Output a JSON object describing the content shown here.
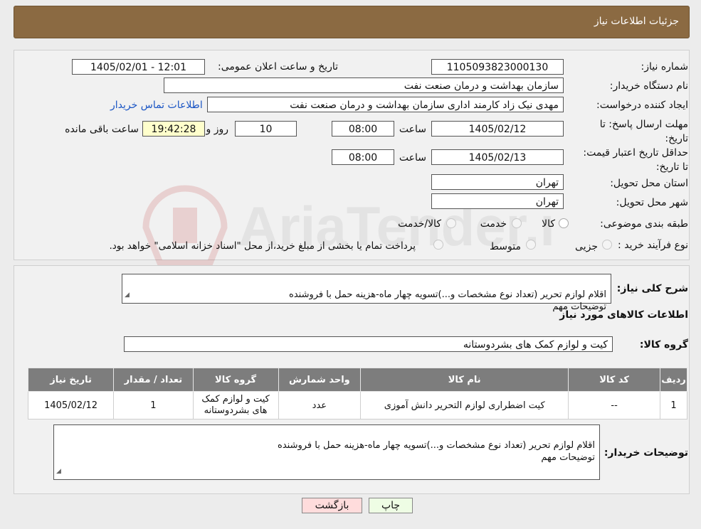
{
  "header": {
    "title": "جزئیات اطلاعات نیاز"
  },
  "form": {
    "need_number_label": "شماره نیاز:",
    "need_number": "1105093823000130",
    "announce_label": "تاریخ و ساعت اعلان عمومی:",
    "announce_value": "1405/02/01 - 12:01",
    "buyer_org_label": "نام دستگاه خریدار:",
    "buyer_org": "سازمان بهداشت و درمان صنعت نفت",
    "creator_label": "ایجاد کننده درخواست:",
    "creator": "مهدی نیک زاد کارمند اداری سازمان بهداشت و درمان صنعت نفت",
    "contact_link": "اطلاعات تماس خریدار",
    "reply_deadline_label": "مهلت ارسال پاسخ: تا تاریخ:",
    "reply_date": "1405/02/12",
    "time_label": "ساعت",
    "reply_time": "08:00",
    "days_value": "10",
    "days_label": "روز و",
    "remaining_time": "19:42:28",
    "remaining_label": "ساعت باقی مانده",
    "price_validity_label": "حداقل تاریخ اعتبار قیمت: تا تاریخ:",
    "price_date": "1405/02/13",
    "price_time": "08:00",
    "province_label": "استان محل تحویل:",
    "province": "تهران",
    "city_label": "شهر محل تحویل:",
    "city": "تهران",
    "category_label": "طبقه بندی موضوعی:",
    "category_options": [
      "کالا",
      "خدمت",
      "کالا/خدمت"
    ],
    "process_label": "نوع فرآیند خرید :",
    "process_options": [
      "جزیی",
      "متوسط"
    ],
    "process_note": "پرداخت تمام یا بخشی از مبلغ خرید،از محل \"اسناد خزانه اسلامی\" خواهد بود."
  },
  "summary": {
    "label": "شرح کلی نیاز:",
    "text": "اقلام لوازم تحریر (تعداد نوع مشخصات و...)تسویه چهار ماه-هزینه حمل با فروشنده\nتوضیحات مهم"
  },
  "goods": {
    "title": "اطلاعات کالاهای مورد نیاز",
    "group_label": "گروه کالا:",
    "group_value": "کیت و لوازم کمک های بشردوستانه",
    "columns": [
      "ردیف",
      "کد کالا",
      "نام کالا",
      "واحد شمارش",
      "گروه کالا",
      "تعداد / مقدار",
      "تاریخ نیاز"
    ],
    "rows": [
      [
        "1",
        "--",
        "کیت اضطراری لوازم التحریر دانش آموزی",
        "عدد",
        "کیت و لوازم کمک های بشردوستانه",
        "1",
        "1405/02/12"
      ]
    ]
  },
  "buyer_notes": {
    "label": "توضیحات خریدار:",
    "text": "اقلام لوازم تحریر (تعداد نوع مشخصات و...)تسویه چهار ماه-هزینه حمل با فروشنده\nتوضیحات مهم"
  },
  "buttons": {
    "print": "چاپ",
    "back": "بازگشت"
  },
  "watermark": {
    "text": "AriaTender.neT"
  }
}
